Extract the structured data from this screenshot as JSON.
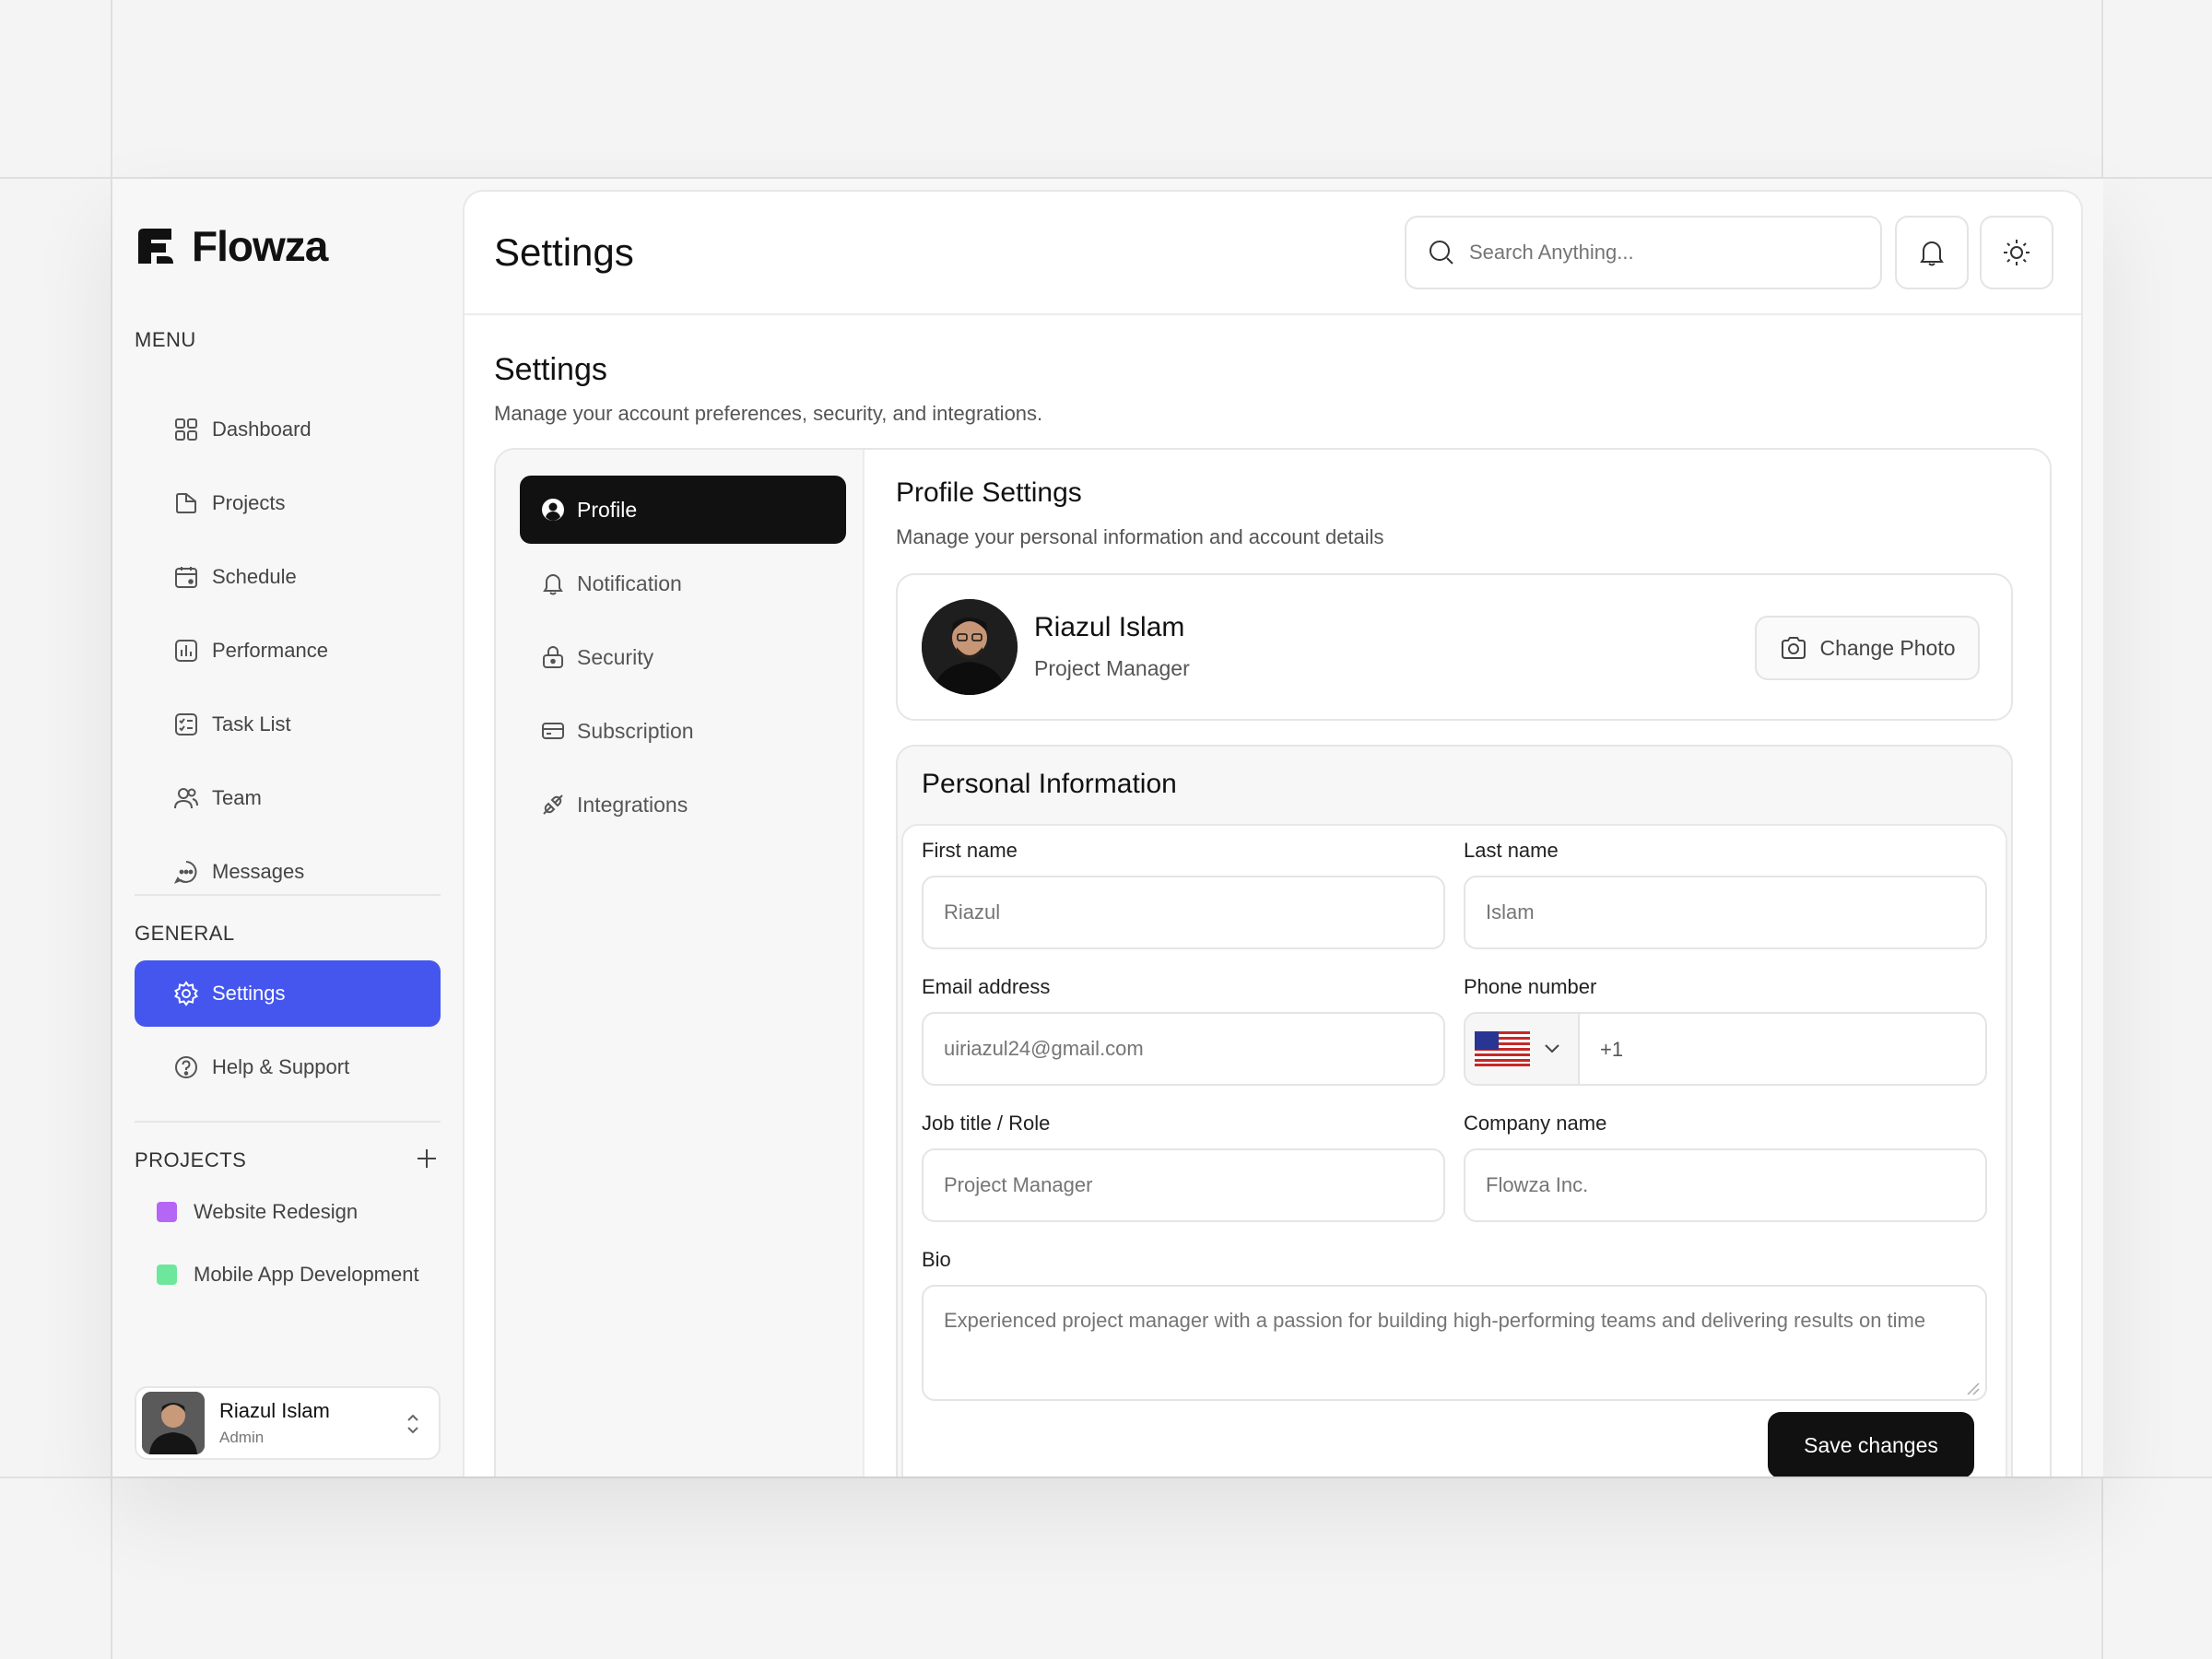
{
  "app": {
    "name": "Flowza"
  },
  "sidebar": {
    "menu_title": "MENU",
    "menu_items": [
      {
        "label": "Dashboard",
        "icon": "grid-icon"
      },
      {
        "label": "Projects",
        "icon": "folder-icon"
      },
      {
        "label": "Schedule",
        "icon": "calendar-icon"
      },
      {
        "label": "Performance",
        "icon": "chart-icon"
      },
      {
        "label": "Task List",
        "icon": "checklist-icon"
      },
      {
        "label": "Team",
        "icon": "users-icon"
      },
      {
        "label": "Messages",
        "icon": "chat-icon"
      }
    ],
    "general_title": "GENERAL",
    "general_items": [
      {
        "label": "Settings",
        "icon": "gear-icon",
        "active": true
      },
      {
        "label": "Help & Support",
        "icon": "help-icon"
      }
    ],
    "projects_title": "PROJECTS",
    "projects": [
      {
        "label": "Website Redesign",
        "color": "#b566f5"
      },
      {
        "label": "Mobile App Development",
        "color": "#6ce79c"
      }
    ],
    "user": {
      "name": "Riazul Islam",
      "role": "Admin"
    }
  },
  "header": {
    "title": "Settings",
    "search_placeholder": "Search Anything..."
  },
  "page": {
    "title": "Settings",
    "subtitle": "Manage your account preferences, security, and integrations."
  },
  "tabs": [
    {
      "label": "Profile",
      "icon": "user-circle-icon",
      "active": true
    },
    {
      "label": "Notification",
      "icon": "bell-icon"
    },
    {
      "label": "Security",
      "icon": "lock-icon"
    },
    {
      "label": "Subscription",
      "icon": "card-icon"
    },
    {
      "label": "Integrations",
      "icon": "plug-icon"
    }
  ],
  "profile": {
    "title": "Profile Settings",
    "subtitle": "Manage your personal information and account details",
    "name": "Riazul Islam",
    "role": "Project Manager",
    "change_photo": "Change Photo"
  },
  "personal": {
    "title": "Personal Information",
    "first_name": {
      "label": "First name",
      "placeholder": "Riazul"
    },
    "last_name": {
      "label": "Last name",
      "placeholder": "Islam"
    },
    "email": {
      "label": "Email address",
      "placeholder": "uiriazul24@gmail.com"
    },
    "phone": {
      "label": "Phone number",
      "code": "+1",
      "country_flag": "us-flag-icon"
    },
    "job": {
      "label": "Job title / Role",
      "placeholder": "Project Manager"
    },
    "company": {
      "label": "Company name",
      "placeholder": "Flowza Inc."
    },
    "bio": {
      "label": "Bio",
      "placeholder": "Experienced project manager with a passion for building high-performing teams and delivering results on time"
    },
    "save": "Save changes"
  },
  "colors": {
    "accent": "#4456ee",
    "dark": "#111111"
  }
}
